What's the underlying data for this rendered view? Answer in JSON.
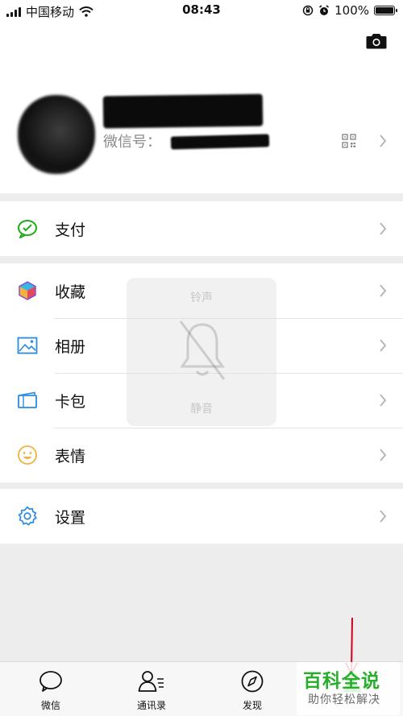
{
  "status_bar": {
    "carrier": "中国移动",
    "time": "08:43",
    "battery": "100%",
    "battery_level": 1.0
  },
  "profile": {
    "wxid_label": "微信号："
  },
  "menu": {
    "pay": "支付",
    "favorites": "收藏",
    "album": "相册",
    "cards": "卡包",
    "stickers": "表情",
    "settings": "设置"
  },
  "overlay": {
    "ringtone": "铃声",
    "silent": "静音"
  },
  "tabbar": {
    "chats": "微信",
    "contacts": "通讯录",
    "discover": "发现"
  },
  "watermark": {
    "title": "百科全说",
    "subtitle": "助你轻松解决"
  },
  "colors": {
    "pay_green": "#1aad19",
    "settings_blue": "#2b8ae0",
    "arrow_red": "#d0021b",
    "watermark_green": "#27ae2a"
  }
}
